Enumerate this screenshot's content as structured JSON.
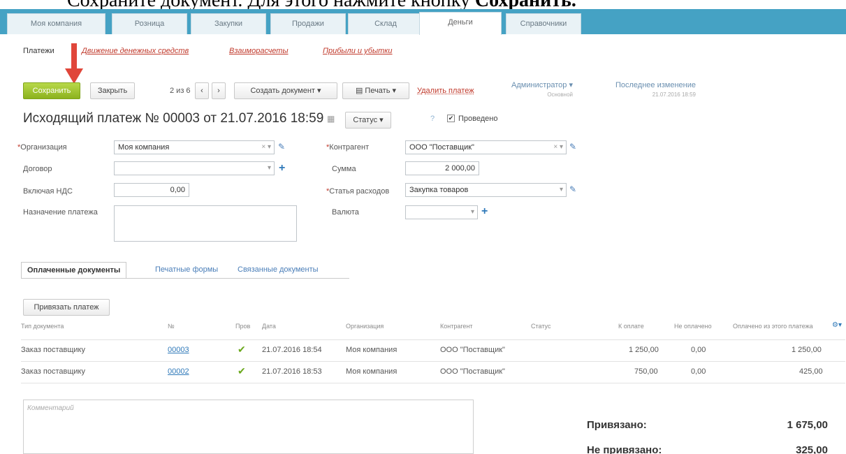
{
  "caption": {
    "part1": "Сохраните документ. Для этого нажмите кнопку ",
    "part2": "Сохранить."
  },
  "nav": {
    "tabs": [
      {
        "label": "Моя компания"
      },
      {
        "label": "Розница"
      },
      {
        "label": "Закупки"
      },
      {
        "label": "Продажи"
      },
      {
        "label": "Склад"
      },
      {
        "label": "Деньги"
      },
      {
        "label": "Справочники"
      }
    ]
  },
  "subnav": {
    "current": "Платежи",
    "links": [
      "Движение денежных средств",
      "Взаиморасчеты",
      "Прибыли и убытки"
    ]
  },
  "toolbar": {
    "save": "Сохранить",
    "close": "Закрыть",
    "pager": "2 из 6",
    "prev": "‹",
    "next": "›",
    "create": "Создать документ ▾",
    "print": "▤ Печать ▾",
    "delete": "Удалить платеж",
    "admin": "Администратор ▾",
    "admin_sub": "Основной",
    "last_change": "Последнее изменение",
    "last_change_date": "21.07.2016 18:59"
  },
  "document": {
    "title": "Исходящий платеж № 00003 от 21.07.2016 18:59",
    "status_btn": "Статус ▾",
    "posted": "Проведено"
  },
  "form": {
    "org_label": "Организация",
    "org_value": "Моя компания",
    "contract_label": "Договор",
    "vat_label": "Включая НДС",
    "vat_value": "0,00",
    "purpose_label": "Назначение платежа",
    "counterparty_label": "Контрагент",
    "counterparty_value": "ООО \"Поставщик\"",
    "sum_label": "Сумма",
    "sum_value": "2 000,00",
    "expense_label": "Статья расходов",
    "expense_value": "Закупка товаров",
    "currency_label": "Валюта"
  },
  "doc_tabs": [
    "Оплаченные документы",
    "Печатные формы",
    "Связанные документы"
  ],
  "bind_btn": "Привязать платеж",
  "table": {
    "headers": [
      "Тип документа",
      "№",
      "Пров",
      "Дата",
      "Организация",
      "Контрагент",
      "Статус",
      "К оплате",
      "Не оплачено",
      "Оплачено из этого платежа"
    ],
    "rows": [
      {
        "type": "Заказ поставщику",
        "num": "00003",
        "check": "✔",
        "date": "21.07.2016 18:54",
        "org": "Моя компания",
        "counterparty": "ООО \"Поставщик\"",
        "to_pay": "1 250,00",
        "unpaid": "0,00",
        "paid": "1 250,00"
      },
      {
        "type": "Заказ поставщику",
        "num": "00002",
        "check": "✔",
        "date": "21.07.2016 18:53",
        "org": "Моя компания",
        "counterparty": "ООО \"Поставщик\"",
        "to_pay": "750,00",
        "unpaid": "0,00",
        "paid": "425,00"
      }
    ]
  },
  "comment_placeholder": "Комментарий",
  "summary": {
    "bound_label": "Привязано:",
    "bound_value": "1 675,00",
    "unbound_label": "Не привязано:",
    "unbound_value": "325,00"
  },
  "colors": {
    "topbar": "#45a2c4",
    "save_green": "#8cb21e",
    "arrow_red": "#e0463a"
  }
}
